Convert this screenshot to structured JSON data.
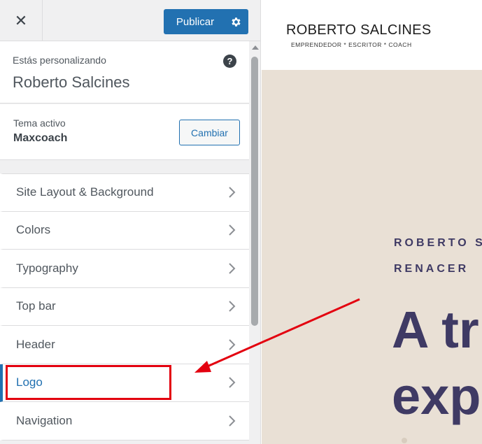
{
  "topbar": {
    "close_symbol": "✕",
    "publish_label": "Publicar",
    "gear_icon": "gear-icon"
  },
  "info": {
    "customizing_label": "Estás personalizando",
    "site_name": "Roberto Salcines",
    "help_symbol": "?"
  },
  "theme": {
    "label": "Tema activo",
    "name": "Maxcoach",
    "change_label": "Cambiar"
  },
  "menu": {
    "items": [
      {
        "label": "Site Layout & Background"
      },
      {
        "label": "Colors"
      },
      {
        "label": "Typography"
      },
      {
        "label": "Top bar"
      },
      {
        "label": "Header"
      },
      {
        "label": "Logo"
      },
      {
        "label": "Navigation"
      }
    ],
    "active_item": "Logo"
  },
  "preview": {
    "logo_title": "ROBERTO SALCINES",
    "logo_tagline": "EMPRENDEDOR * ESCRITOR * COACH",
    "kicker_1": "ROBERTO S",
    "kicker_2": "RENACER",
    "heading_1": "A tr",
    "heading_2": "exp"
  },
  "colors": {
    "accent": "#2271b1",
    "annotation": "#e3000f",
    "hero_text": "#3f3a64",
    "hero_bg": "#e9e0d5"
  }
}
